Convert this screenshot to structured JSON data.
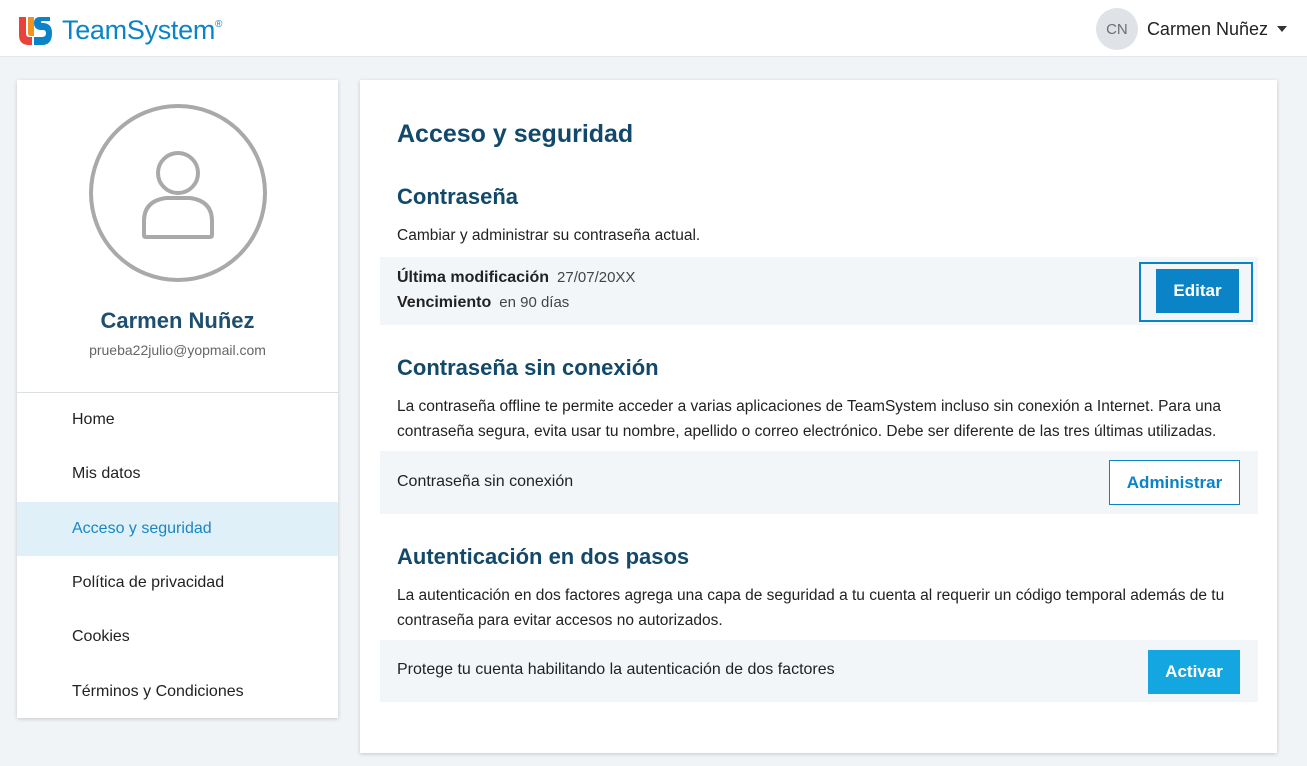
{
  "brand": {
    "name": "TeamSystem",
    "mark": "®",
    "colors": {
      "primary": "#0a84c6",
      "title": "#12496b",
      "activate": "#14a6e0",
      "logo_red": "#e8423b",
      "logo_orange": "#f39221"
    }
  },
  "header": {
    "avatar_initials": "CN",
    "user_name": "Carmen Nuñez"
  },
  "sidebar": {
    "profile_name": "Carmen Nuñez",
    "profile_email": "prueba22julio@yopmail.com",
    "items": [
      {
        "label": "Home"
      },
      {
        "label": "Mis datos"
      },
      {
        "label": "Acceso y seguridad"
      },
      {
        "label": "Política de privacidad"
      },
      {
        "label": "Cookies"
      },
      {
        "label": "Términos y Condiciones"
      }
    ]
  },
  "main": {
    "title": "Acceso y seguridad",
    "password": {
      "title": "Contraseña",
      "description": "Cambiar y administrar su contraseña actual.",
      "last_modified_label": "Última modificación",
      "last_modified_value": "27/07/20XX",
      "expiry_label": "Vencimiento",
      "expiry_value": "en 90 días",
      "edit_button": "Editar"
    },
    "offline": {
      "title": "Contraseña sin conexión",
      "description_line1": "La contraseña offline te permite acceder a varias aplicaciones de TeamSystem incluso sin conexión a Internet. Para una",
      "description_line2": "contraseña segura, evita usar tu nombre, apellido o correo electrónico. Debe ser diferente de las tres últimas utilizadas.",
      "panel_label": "Contraseña sin conexión",
      "manage_button": "Administrar"
    },
    "two_factor": {
      "title": "Autenticación en dos pasos",
      "description_line1": "La autenticación en dos factores agrega una capa de seguridad a tu cuenta al requerir un código temporal además de tu",
      "description_line2": "contraseña para evitar accesos no autorizados.",
      "panel_label": "Protege tu cuenta habilitando la autenticación de dos factores",
      "activate_button": "Activar"
    }
  }
}
